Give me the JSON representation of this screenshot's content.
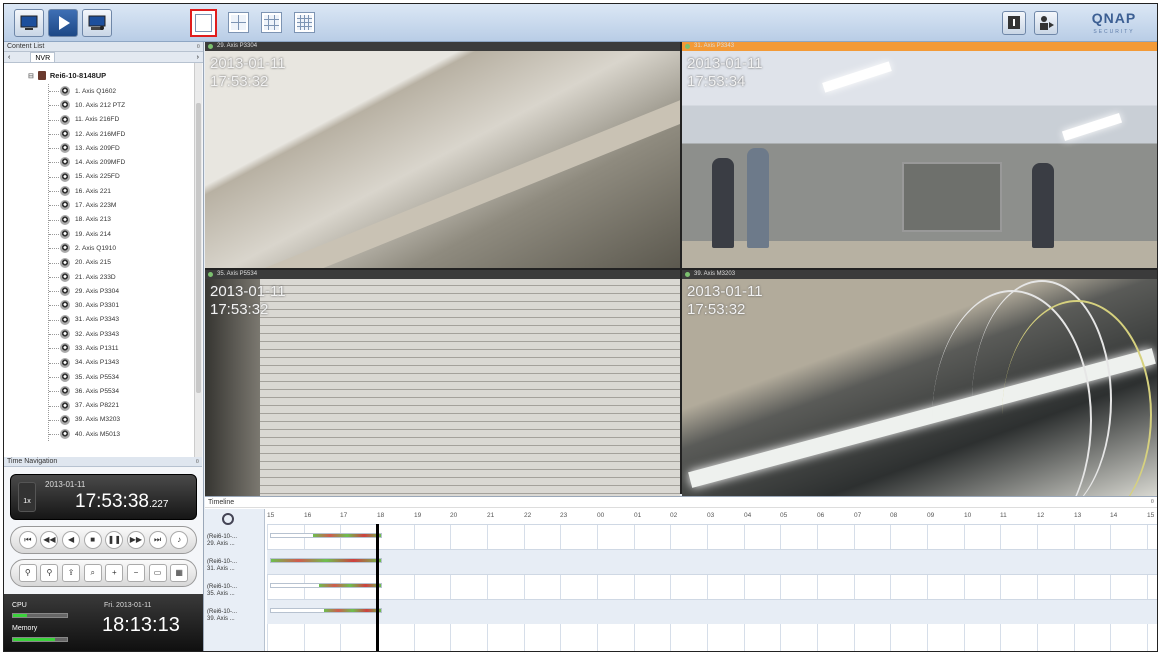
{
  "sidebar": {
    "content_list_title": "Content List",
    "tab": "NVR",
    "server": "Rei6-10-8148UP",
    "cameras": [
      "1. Axis Q1602",
      "10. Axis 212 PTZ",
      "11. Axis 216FD",
      "12. Axis 216MFD",
      "13. Axis 209FD",
      "14. Axis 209MFD",
      "15. Axis 225FD",
      "16. Axis 221",
      "17. Axis 223M",
      "18. Axis 213",
      "19. Axis 214",
      "2. Axis Q1910",
      "20. Axis 215",
      "21. Axis 233D",
      "29. Axis P3304",
      "30. Axis P3301",
      "31. Axis P3343",
      "32. Axis P3343",
      "33. Axis P1311",
      "34. Axis P1343",
      "35. Axis P5534",
      "36. Axis P5534",
      "37. Axis P8221",
      "39. Axis M3203",
      "40. Axis M5013"
    ]
  },
  "time_navigation": {
    "title": "Time Navigation",
    "date": "2013-01-11",
    "time": "17:53:38",
    "ms": ".227",
    "speed": "1x"
  },
  "system": {
    "cpu_label": "CPU",
    "memory_label": "Memory",
    "cpu_level": 0.25,
    "memory_level": 0.78,
    "date": "Fri. 2013-01-11",
    "time": "18:13:13"
  },
  "videos": [
    {
      "name": "29. Axis P3304",
      "date": "2013-01-11",
      "time": "17:53:32",
      "active": false
    },
    {
      "name": "31. Axis P3343",
      "date": "2013-01-11",
      "time": "17:53:34",
      "active": true
    },
    {
      "name": "35. Axis P5534",
      "date": "2013-01-11",
      "time": "17:53:32",
      "active": false
    },
    {
      "name": "39. Axis M3203",
      "date": "2013-01-11",
      "time": "17:53:32",
      "active": false
    }
  ],
  "timeline": {
    "title": "Timeline",
    "hours": [
      "15",
      "16",
      "17",
      "18",
      "19",
      "20",
      "21",
      "22",
      "23",
      "00",
      "01",
      "02",
      "03",
      "04",
      "05",
      "06",
      "07",
      "08",
      "09",
      "10",
      "11",
      "12",
      "13",
      "14",
      "15"
    ],
    "rows": [
      {
        "line1": "(Rei6-10-...",
        "line2": "29. Axis ..."
      },
      {
        "line1": "(Rei6-10-...",
        "line2": "31. Axis ..."
      },
      {
        "line1": "(Rei6-10-...",
        "line2": "35. Axis ..."
      },
      {
        "line1": "(Rei6-10-...",
        "line2": "39. Axis ..."
      }
    ]
  },
  "brand": {
    "name": "QNAP",
    "sub": "SECURITY"
  },
  "colors": {
    "accent": "#f39a37",
    "selection_outline": "#e01d1d",
    "record": "#cf3f3f",
    "motion": "#6cbf4e"
  }
}
